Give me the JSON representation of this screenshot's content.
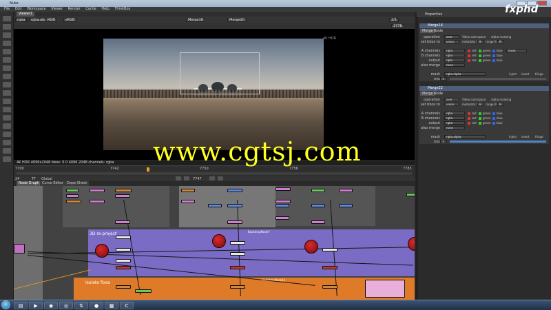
{
  "titlebar": {
    "text": "Nuke"
  },
  "menubar": [
    "File",
    "Edit",
    "Workspace",
    "Viewer",
    "Render",
    "Cache",
    "Help",
    "ThinkBox"
  ],
  "viewer": {
    "tab": "Viewer1",
    "channels": "rgba",
    "alpha": "rgba.alpha",
    "colorspace": "RGB",
    "display": "sRGB",
    "input_a": "Merge16",
    "input_b": "Merge20",
    "frame": "2/1",
    "zoom": "2778",
    "image_format": "4K HDR",
    "info_bar": "4K HDR 4096x2048 bbox: 0 0 4096 2048 channels: rgba"
  },
  "timeline": {
    "start": "7700",
    "mid1": "7742",
    "mid2": "7750",
    "mid3": "7756",
    "end": "7785",
    "current": "7747",
    "fps": "24",
    "mode": "TF",
    "range": "Global"
  },
  "nodegraph": {
    "tabs": [
      "Node Graph",
      "Curve Editor",
      "Dope Sheet"
    ],
    "backdrop_3d": "3D re-project",
    "backdrop_3d_id": "BackdropNode7",
    "backdrop_isolate": "Isolate fixes",
    "backdrop_isolate_id": "BackdropNode11"
  },
  "properties": {
    "title": "Properties",
    "panels": [
      {
        "name": "Merge16",
        "tabs": [
          "Merge",
          "Node"
        ],
        "operation": "over",
        "video_colorspace": "Video colorspace",
        "alpha_masking": "alpha masking",
        "set_bbox": "union",
        "metadata_from": "metadata from",
        "metadata_val": "B",
        "range_from": "range from",
        "range_val": "B",
        "a_channels": "rgba",
        "b_channels": "rgba",
        "output": "rgba",
        "also_merge": "none",
        "mask": "rgba.alpha",
        "mix": "1"
      },
      {
        "name": "Merge22",
        "tabs": [
          "Merge",
          "Node"
        ],
        "operation": "over",
        "video_colorspace": "Video colorspace",
        "alpha_masking": "alpha masking",
        "set_bbox": "union",
        "metadata_from": "metadata from",
        "metadata_val": "B",
        "range_from": "range from",
        "range_val": "B",
        "a_channels": "rgba",
        "b_channels": "rgba",
        "output": "rgba",
        "also_merge": "none",
        "mask": "rgba.alpha",
        "mix": "1"
      }
    ],
    "labels": {
      "operation": "operation",
      "set_bbox": "set bbox to",
      "a_channels": "A channels",
      "b_channels": "B channels",
      "output": "output",
      "also_merge": "also merge",
      "mask": "mask",
      "mix": "mix",
      "red": "red",
      "green": "green",
      "blue": "blue",
      "inject": "inject",
      "invert": "invert",
      "fringe": "fringe"
    }
  },
  "logo": "fxphd",
  "watermark": "www.cgtsj.com",
  "taskbar": {
    "apps": [
      "explorer",
      "media",
      "firefox",
      "chrome",
      "ftp",
      "nuke",
      "cinema",
      "search"
    ]
  }
}
